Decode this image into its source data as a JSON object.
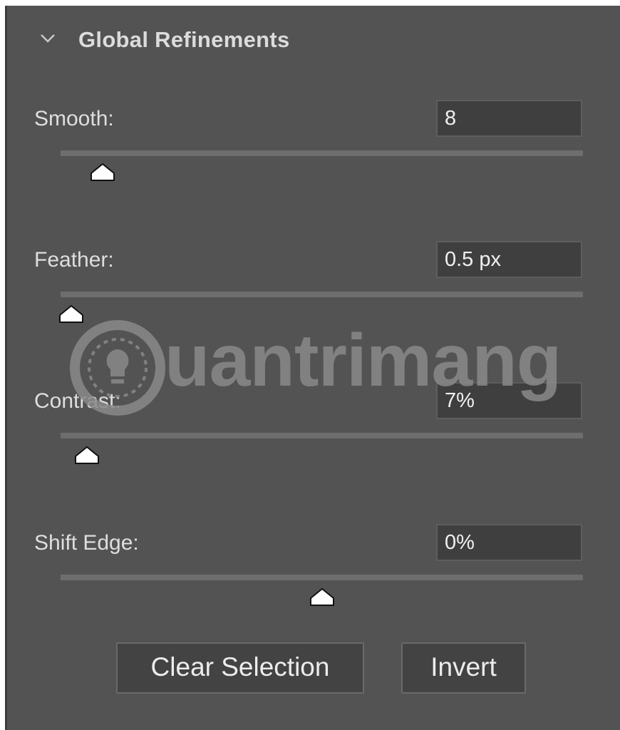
{
  "panel": {
    "section_title": "Global Refinements",
    "chevron_icon": "chevron-down-icon"
  },
  "controls": [
    {
      "key": "smooth",
      "label": "Smooth:",
      "value": "8",
      "slider_fraction": 0.08
    },
    {
      "key": "feather",
      "label": "Feather:",
      "value": "0.5 px",
      "slider_fraction": 0.02
    },
    {
      "key": "contrast",
      "label": "Contrast:",
      "value": "7%",
      "slider_fraction": 0.05
    },
    {
      "key": "shift-edge",
      "label": "Shift Edge:",
      "value": "0%",
      "slider_fraction": 0.5
    }
  ],
  "buttons": {
    "clear_selection": "Clear Selection",
    "invert": "Invert"
  },
  "watermark": {
    "text": "uantrimang",
    "icon": "lightbulb-icon"
  },
  "colors": {
    "panel_bg": "#535353",
    "field_bg": "#3f3f3f",
    "track": "#6e6e6e",
    "thumb": "#ffffff",
    "text": "#dedede"
  }
}
